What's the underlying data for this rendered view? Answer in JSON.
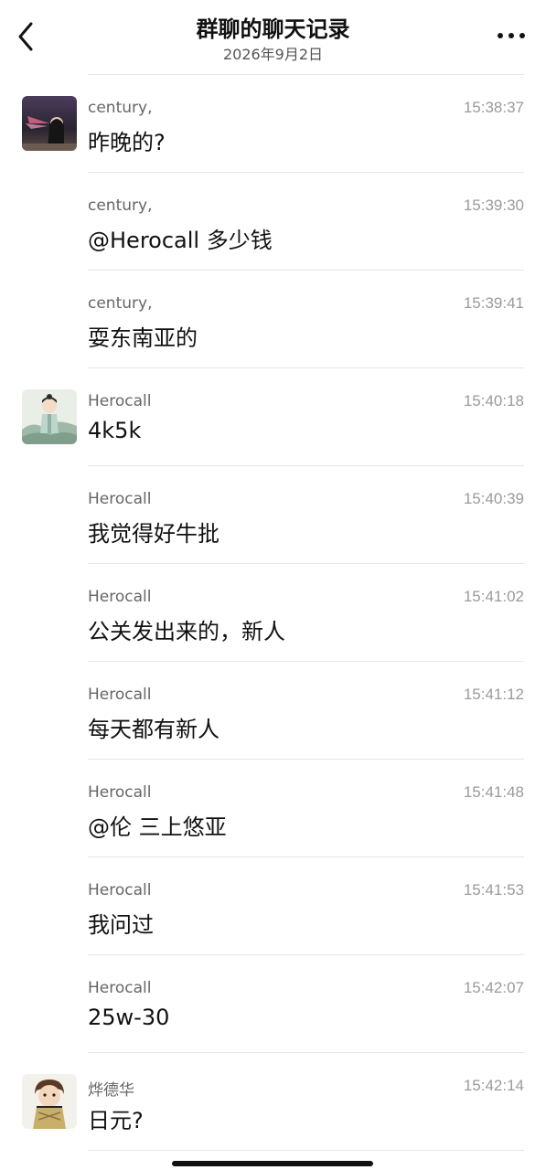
{
  "header": {
    "title": "群聊的聊天记录",
    "date": "2026年9月2日"
  },
  "icons": {
    "back": "chevron-left-icon",
    "more": "more-dots-icon"
  },
  "messages": [
    {
      "sender": "century,",
      "time": "15:38:37",
      "text": "昨晚的?",
      "avatar": "avatar-century"
    },
    {
      "sender": "century,",
      "time": "15:39:30",
      "text": "@Herocall 多少钱"
    },
    {
      "sender": "century,",
      "time": "15:39:41",
      "text": "耍东南亚的"
    },
    {
      "sender": "Herocall",
      "time": "15:40:18",
      "text": "4k5k",
      "avatar": "avatar-herocall"
    },
    {
      "sender": "Herocall",
      "time": "15:40:39",
      "text": "我觉得好牛批"
    },
    {
      "sender": "Herocall",
      "time": "15:41:02",
      "text": "公关发出来的，新人"
    },
    {
      "sender": "Herocall",
      "time": "15:41:12",
      "text": "每天都有新人"
    },
    {
      "sender": "Herocall",
      "time": "15:41:48",
      "text": "@伦 三上悠亚"
    },
    {
      "sender": "Herocall",
      "time": "15:41:53",
      "text": "我问过"
    },
    {
      "sender": "Herocall",
      "time": "15:42:07",
      "text": "25w-30"
    },
    {
      "sender": "烨德华",
      "time": "15:42:14",
      "text": "日元?",
      "avatar": "avatar-yedehua"
    }
  ]
}
